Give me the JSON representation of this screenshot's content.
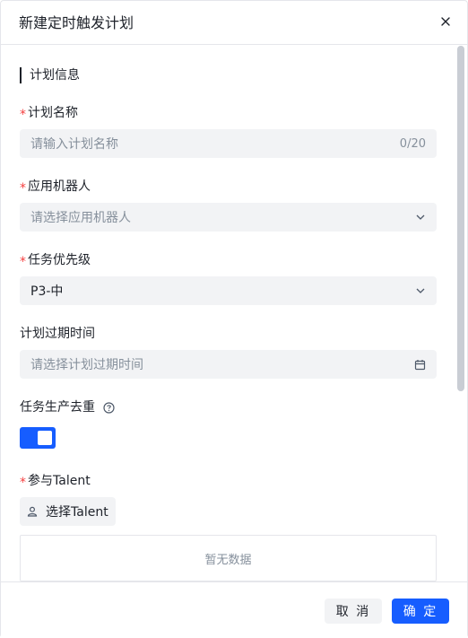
{
  "dialog": {
    "title": "新建定时触发计划"
  },
  "section": {
    "title": "计划信息"
  },
  "fields": {
    "plan_name": {
      "required_mark": "*",
      "label": "计划名称",
      "placeholder": "请输入计划名称",
      "counter": "0/20"
    },
    "robot": {
      "required_mark": "*",
      "label": "应用机器人",
      "placeholder": "请选择应用机器人"
    },
    "priority": {
      "required_mark": "*",
      "label": "任务优先级",
      "value": "P3-中"
    },
    "expire": {
      "label": "计划过期时间",
      "placeholder": "请选择计划过期时间"
    },
    "dedupe": {
      "label": "任务生产去重",
      "enabled": true
    },
    "talent": {
      "required_mark": "*",
      "label": "参与Talent",
      "button_label": "选择Talent",
      "empty_text": "暂无数据"
    }
  },
  "footer": {
    "cancel_label": "取 消",
    "ok_label": "确 定"
  },
  "colors": {
    "primary": "#165dff",
    "required": "#f53f3f",
    "field_bg": "#f2f3f5"
  }
}
